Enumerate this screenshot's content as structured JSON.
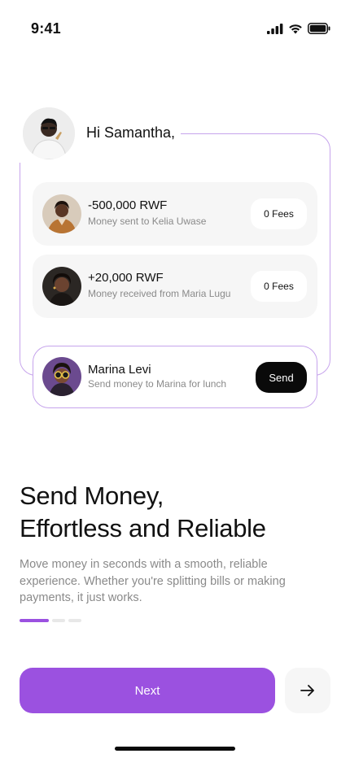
{
  "status_bar": {
    "time": "9:41",
    "icons": [
      "cellular-signal-icon",
      "wifi-icon",
      "battery-icon"
    ]
  },
  "greeting": {
    "text": "Hi Samantha,"
  },
  "transactions": [
    {
      "amount": "-500,000 RWF",
      "description": "Money sent to Kelia Uwase",
      "fee_label": "0 Fees"
    },
    {
      "amount": "+20,000 RWF",
      "description": "Money received from Maria Lugu",
      "fee_label": "0 Fees"
    }
  ],
  "contact": {
    "name": "Marina Levi",
    "description": "Send money to Marina for lunch",
    "action_label": "Send"
  },
  "onboarding": {
    "headline_line1": "Send Money,",
    "headline_line2": "Effortless and Reliable",
    "body": "Move money in seconds with a smooth, reliable experience. Whether you're splitting bills or making payments, it just works.",
    "page_count": 3,
    "current_page": 1
  },
  "buttons": {
    "next_label": "Next",
    "arrow_icon": "arrow-right-icon"
  },
  "colors": {
    "accent": "#9b51e0",
    "outline": "#c6a4ec",
    "card_bg": "#f6f6f6",
    "send_button": "#0a0a0a"
  }
}
